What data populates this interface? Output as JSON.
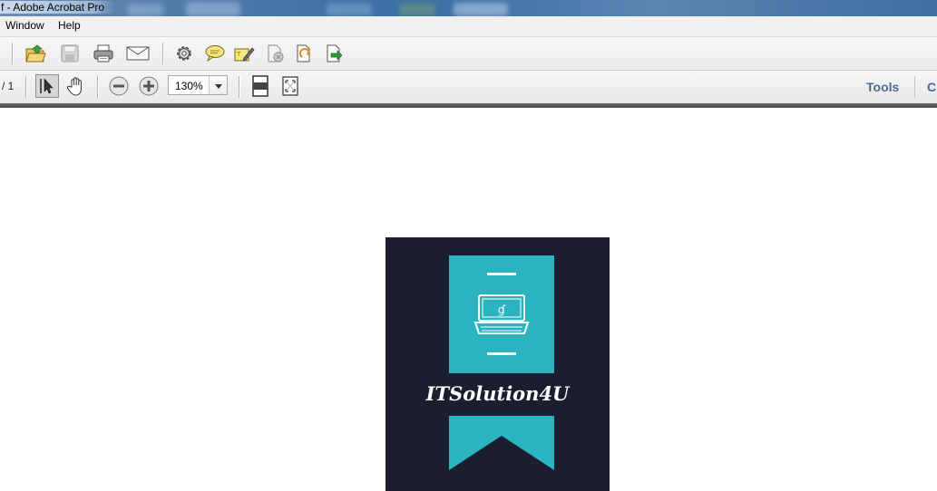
{
  "window": {
    "title": "f - Adobe Acrobat Pro"
  },
  "menu": {
    "items": [
      "Window",
      "Help"
    ]
  },
  "toolbar1": {
    "icons": [
      "open-folder-icon",
      "save-icon",
      "print-icon",
      "email-icon",
      "settings-gear-icon",
      "comment-bubble-icon",
      "sign-pen-icon",
      "delete-page-icon",
      "edit-document-icon",
      "export-document-icon"
    ]
  },
  "toolbar2": {
    "page_count": "/ 1",
    "zoom": "130%",
    "tools_label": "Tools",
    "comment_label": "C"
  },
  "document": {
    "logo_text": "ITSolution4U",
    "colors": {
      "logo_background": "#1b1e2e",
      "logo_accent": "#2bb4c0"
    }
  }
}
